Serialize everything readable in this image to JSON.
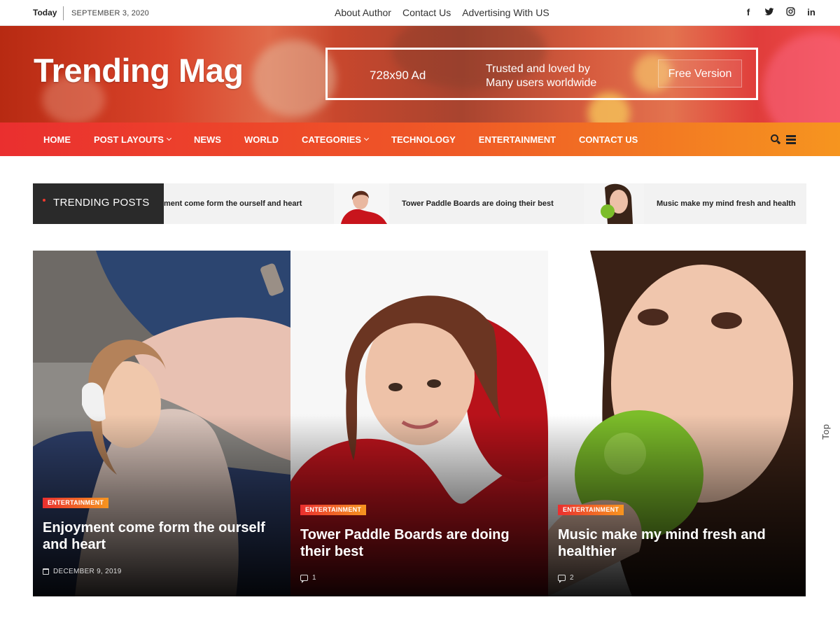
{
  "topbar": {
    "today_label": "Today",
    "date": "SEPTEMBER 3, 2020",
    "links": [
      "About Author",
      "Contact Us",
      "Advertising With US"
    ],
    "social_icons": [
      {
        "name": "facebook-icon",
        "glyph": "f"
      },
      {
        "name": "twitter-icon",
        "glyph": "t"
      },
      {
        "name": "instagram-icon",
        "glyph": "◎"
      },
      {
        "name": "linkedin-icon",
        "glyph": "in"
      }
    ]
  },
  "header": {
    "logo": "Trending Mag",
    "ad": {
      "size": "728x90 Ad",
      "line1": "Trusted and loved by",
      "line2": "Many users worldwide",
      "free": "Free Version"
    }
  },
  "nav": {
    "items": [
      {
        "label": "HOME",
        "dropdown": false
      },
      {
        "label": "POST LAYOUTS",
        "dropdown": true
      },
      {
        "label": "NEWS",
        "dropdown": false
      },
      {
        "label": "WORLD",
        "dropdown": false
      },
      {
        "label": "CATEGORIES",
        "dropdown": true
      },
      {
        "label": "TECHNOLOGY",
        "dropdown": false
      },
      {
        "label": "ENTERTAINMENT",
        "dropdown": false
      },
      {
        "label": "CONTACT US",
        "dropdown": false
      }
    ],
    "icons": [
      "search-icon",
      "menu-icon"
    ]
  },
  "trending": {
    "label": "TRENDING POSTS",
    "items": [
      {
        "title": "ment come form the ourself and heart"
      },
      {
        "title": "Tower Paddle Boards are doing their best"
      },
      {
        "title": "Music make my mind fresh and health"
      }
    ]
  },
  "cards": [
    {
      "category": "ENTERTAINMENT",
      "title": "Enjoyment come form the ourself and heart",
      "meta": "DECEMBER 9, 2019",
      "meta_icon": "calendar-icon"
    },
    {
      "category": "ENTERTAINMENT",
      "title": "Tower Paddle Boards are doing their best",
      "meta": "1",
      "meta_icon": "comment-icon"
    },
    {
      "category": "ENTERTAINMENT",
      "title": "Music make my mind fresh and healthier",
      "meta": "2",
      "meta_icon": "comment-icon"
    }
  ],
  "back_to_top": "Top",
  "colors": {
    "nav_start": "#ea2f2f",
    "nav_end": "#f6951f",
    "ticker_label_bg": "#2a2a2a"
  }
}
